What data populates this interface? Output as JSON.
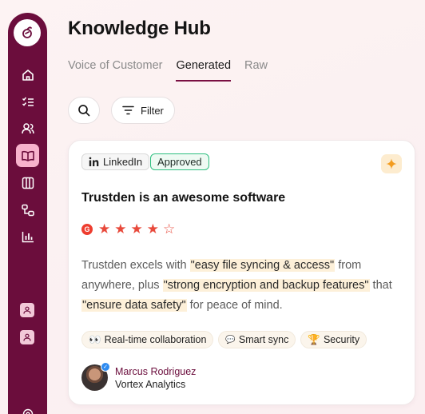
{
  "header": {
    "title": "Knowledge Hub"
  },
  "tabs": [
    {
      "label": "Voice of Customer",
      "active": false
    },
    {
      "label": "Generated",
      "active": true
    },
    {
      "label": "Raw",
      "active": false
    }
  ],
  "toolbar": {
    "filter_label": "Filter"
  },
  "sidebar": {
    "items": [
      {
        "icon": "home-icon"
      },
      {
        "icon": "checklist-icon"
      },
      {
        "icon": "users-icon"
      },
      {
        "icon": "book-icon",
        "active": true
      },
      {
        "icon": "columns-icon"
      },
      {
        "icon": "workflow-icon"
      },
      {
        "icon": "bar-chart-icon"
      }
    ]
  },
  "card": {
    "source": "LinkedIn",
    "status": "Approved",
    "title": "Trustden is an awesome software",
    "rating": 4,
    "rating_max": 5,
    "body": {
      "p1": "Trustden excels with ",
      "h1": "\"easy file syncing & access\"",
      "p2": " from anywhere, plus ",
      "h2": "\"strong encryption and backup features\"",
      "p3": " that ",
      "h3": "\"ensure data safety\"",
      "p4": " for peace of mind."
    },
    "tags": [
      {
        "emoji": "👀",
        "label": "Real-time collaboration"
      },
      {
        "emoji": "💬",
        "label": "Smart sync"
      },
      {
        "emoji": "🏆",
        "label": "Security"
      }
    ],
    "author": {
      "name": "Marcus Rodriguez",
      "company": "Vortex Analytics"
    }
  },
  "colors": {
    "brand": "#6b0d3c",
    "accent_pink": "#f7b2cc",
    "approved": "#2fbf80",
    "star": "#e8493b"
  }
}
